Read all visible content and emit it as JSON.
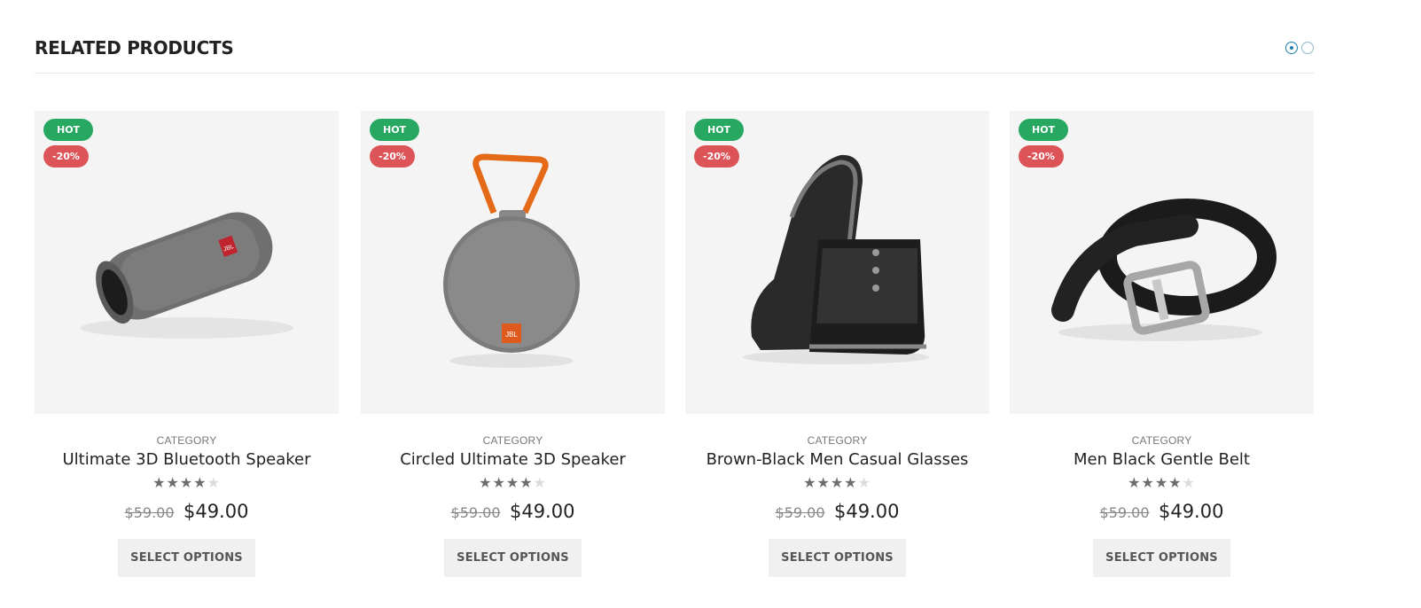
{
  "section": {
    "title": "RELATED PRODUCTS"
  },
  "carousel": {
    "pages": 2,
    "active_page": 1
  },
  "colors": {
    "hot_badge": "#27a860",
    "sale_badge": "#dc5457",
    "active_dot": "#1d7fae"
  },
  "products": [
    {
      "hot_label": "HOT",
      "discount_label": "-20%",
      "image": "bluetooth-speaker-image",
      "category": "CATEGORY",
      "name": "Ultimate 3D Bluetooth Speaker",
      "rating": 4,
      "rating_max": 5,
      "old_price": "$59.00",
      "price": "$49.00",
      "button_label": "SELECT OPTIONS"
    },
    {
      "hot_label": "HOT",
      "discount_label": "-20%",
      "image": "round-speaker-image",
      "category": "CATEGORY",
      "name": "Circled Ultimate 3D Speaker",
      "rating": 4,
      "rating_max": 5,
      "old_price": "$59.00",
      "price": "$49.00",
      "button_label": "SELECT OPTIONS"
    },
    {
      "hot_label": "HOT",
      "discount_label": "-20%",
      "image": "boots-image",
      "category": "CATEGORY",
      "name": "Brown-Black Men Casual Glasses",
      "rating": 4,
      "rating_max": 5,
      "old_price": "$59.00",
      "price": "$49.00",
      "button_label": "SELECT OPTIONS"
    },
    {
      "hot_label": "HOT",
      "discount_label": "-20%",
      "image": "belt-image",
      "category": "CATEGORY",
      "name": "Men Black Gentle Belt",
      "rating": 4,
      "rating_max": 5,
      "old_price": "$59.00",
      "price": "$49.00",
      "button_label": "SELECT OPTIONS"
    }
  ]
}
